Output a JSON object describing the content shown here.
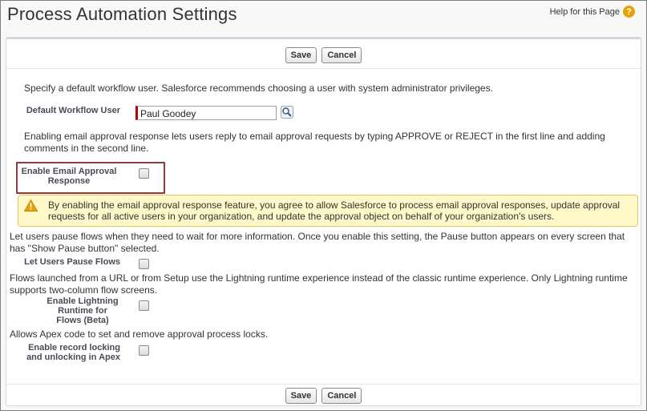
{
  "page": {
    "title": "Process Automation Settings",
    "help_link": "Help for this Page"
  },
  "buttons": {
    "save": "Save",
    "cancel": "Cancel"
  },
  "workflow_user": {
    "description": "Specify a default workflow user. Salesforce recommends choosing a user with system administrator privileges.",
    "label": "Default Workflow User",
    "value": "Paul Goodey"
  },
  "email_approval": {
    "description": "Enabling email approval response lets users reply to email approval requests by typing APPROVE or REJECT in the first line and adding comments in the second line.",
    "label": "Enable Email Approval Response",
    "checked": false,
    "warning": "By enabling the email approval response feature, you agree to allow Salesforce to process email approval responses, update approval requests for all active users in your organization, and update the approval object on behalf of your organization's users."
  },
  "pause_flows": {
    "description": "Let users pause flows when they need to wait for more information. Once you enable this setting, the Pause button appears on every screen that has \"Show Pause button\" selected.",
    "label": "Let Users Pause Flows",
    "checked": false
  },
  "lightning_runtime": {
    "description": "Flows launched from a URL or from Setup use the Lightning runtime experience instead of the classic runtime experience. Only Lightning runtime supports two-column flow screens.",
    "label": "Enable Lightning Runtime for Flows (Beta)",
    "checked": false
  },
  "record_locking": {
    "description": "Allows Apex code to set and remove approval process locks.",
    "label": "Enable record locking and unlocking in Apex",
    "checked": false
  },
  "colors": {
    "highlight_border": "#8b3b3b",
    "warning_bg": "#fff8c8",
    "help_icon": "#e8a10a",
    "required_marker": "#c00000"
  },
  "icons": {
    "help": "question-circle-icon",
    "lookup": "magnifier-lookup-icon",
    "warning": "warning-triangle-icon"
  }
}
